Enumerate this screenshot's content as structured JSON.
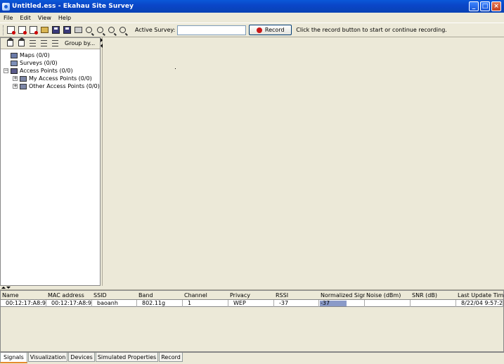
{
  "window": {
    "title": "Untitled.ess - Ekahau Site Survey",
    "controls": [
      "minimize",
      "maximize",
      "close"
    ]
  },
  "menu": [
    "File",
    "Edit",
    "View",
    "Help"
  ],
  "toolbar": {
    "active_survey_label": "Active Survey:",
    "active_survey_value": "",
    "record_label": "Record",
    "hint": "Click the record button to start or continue recording."
  },
  "left_panel": {
    "group_by_label": "Group by...",
    "tree": [
      {
        "label": "Maps  (0/0)"
      },
      {
        "label": "Surveys  (0/0)"
      },
      {
        "label": "Access Points  (0/0)"
      },
      {
        "label": "My Access Points  (0/0)"
      },
      {
        "label": "Other Access Points  (0/0)"
      }
    ]
  },
  "table": {
    "columns": [
      "Name",
      "MAC address",
      "SSID",
      "Band",
      "Channel",
      "Privacy",
      "RSSI",
      "Normalized Signa...",
      "Noise (dBm)",
      "SNR (dB)",
      "Last Update Time"
    ],
    "rows": [
      {
        "name": "00:12:17:A8:97...",
        "mac": "00:12:17:A8:97...",
        "ssid": "baoanh",
        "band": "802.11g",
        "channel": "1",
        "privacy": "WEP",
        "rssi": "-37",
        "normalized": "-37",
        "normalized_fraction": 0.6,
        "noise": "",
        "snr": "",
        "last_update": "8/22/04 9:57:2..."
      }
    ]
  },
  "tabs": [
    "Signals",
    "Visualization",
    "Devices",
    "Simulated Properties",
    "Record"
  ],
  "colors": {
    "titlebar": "#0a46c8",
    "record_dot": "#c81818",
    "normalized_bar": "#8a9ac8",
    "active_tab_accent": "#e68b2c"
  }
}
